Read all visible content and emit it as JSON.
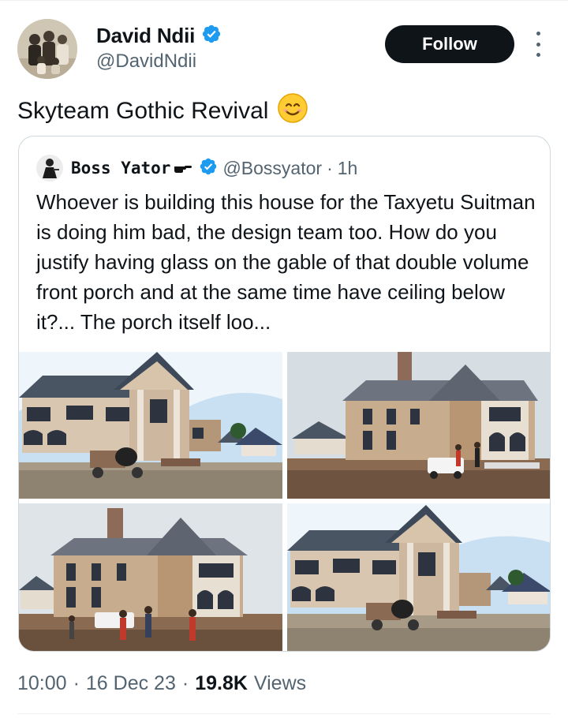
{
  "tweet": {
    "author": {
      "display_name": "David Ndii",
      "handle": "@DavidNdii",
      "verified": true,
      "avatar_icon": "sepia-family-photo"
    },
    "follow_label": "Follow",
    "text": "Skyteam Gothic Revival",
    "emoji": "smiling-face-emoji",
    "meta": {
      "time": "10:00",
      "date": "16 Dec 23",
      "views_count": "19.8K",
      "views_label": "Views",
      "separator": "·"
    }
  },
  "quoted_tweet": {
    "author": {
      "display_name": "Boss Yator",
      "handle": "@Bossyator",
      "verified": true,
      "emoji": "pointing-hand-emoji"
    },
    "separator": "·",
    "age": "1h",
    "text": "Whoever is building this house for the Taxyetu Suitman is doing him bad, the design team too. How do you justify having glass on the gable of that double volume front porch and at the same time have ceiling below it?... The porch itself loo...",
    "media": [
      {
        "name": "house-photo-front-porch-mixer"
      },
      {
        "name": "house-photo-side-view-pickup"
      },
      {
        "name": "house-photo-side-view-workers"
      },
      {
        "name": "house-photo-front-porch-wide"
      }
    ]
  },
  "colors": {
    "text_primary": "#0f1419",
    "text_secondary": "#536471",
    "verified_blue": "#1d9bf0",
    "border": "#cfd9de"
  }
}
